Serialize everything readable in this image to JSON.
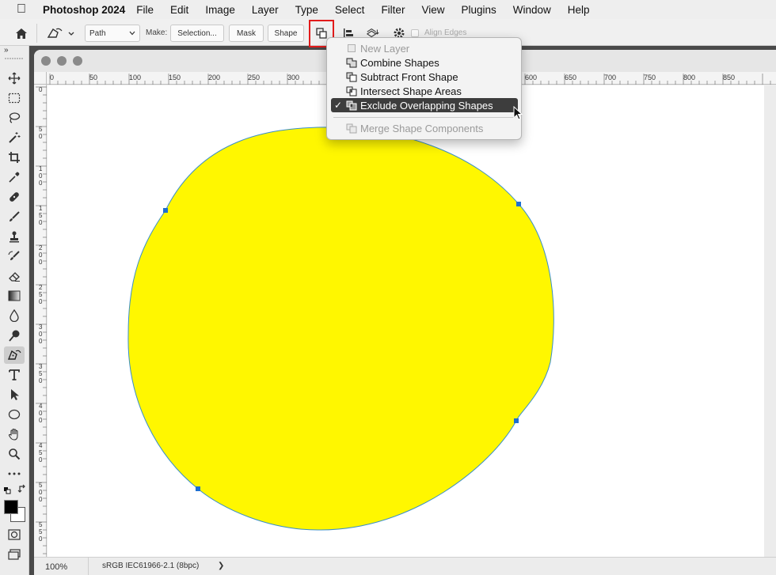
{
  "menubar": {
    "app_name": "Photoshop 2024",
    "items": [
      "File",
      "Edit",
      "Image",
      "Layer",
      "Type",
      "Select",
      "Filter",
      "View",
      "Plugins",
      "Window",
      "Help"
    ]
  },
  "options_bar": {
    "mode_select": "Path",
    "make_label": "Make:",
    "selection_button": "Selection...",
    "mask_button": "Mask",
    "shape_button": "Shape",
    "align_edges_label": "Align Edges"
  },
  "path_operations_menu": {
    "items": [
      {
        "label": "New Layer",
        "disabled": true,
        "checked": false,
        "icon": "new-layer-icon"
      },
      {
        "label": "Combine Shapes",
        "disabled": false,
        "checked": false,
        "icon": "combine-shapes-icon"
      },
      {
        "label": "Subtract Front Shape",
        "disabled": false,
        "checked": false,
        "icon": "subtract-front-shape-icon"
      },
      {
        "label": "Intersect Shape Areas",
        "disabled": false,
        "checked": false,
        "icon": "intersect-shape-areas-icon"
      },
      {
        "label": "Exclude Overlapping Shapes",
        "disabled": false,
        "checked": true,
        "icon": "exclude-overlapping-shapes-icon"
      }
    ],
    "merge_label": "Merge Shape Components",
    "check_mark": "✓"
  },
  "rulers": {
    "horizontal": [
      "0",
      "50",
      "100",
      "150",
      "200",
      "250",
      "300",
      "600",
      "650",
      "700",
      "750",
      "800",
      "850"
    ],
    "vertical": [
      "0",
      "5\n0",
      "1\n0\n0",
      "1\n5\n0",
      "2\n0\n0",
      "2\n5\n0",
      "3\n0\n0",
      "3\n5\n0",
      "4\n0\n0",
      "4\n5\n0",
      "5\n0\n0",
      "5\n5\n0"
    ]
  },
  "status": {
    "zoom": "100%",
    "profile": "sRGB IEC61966-2.1 (8bpc)",
    "arrow": "❯"
  },
  "shape": {
    "fill_color": "#FFF700",
    "stroke_color": "#3A8FC9",
    "anchor_color": "#1E6FD0"
  }
}
